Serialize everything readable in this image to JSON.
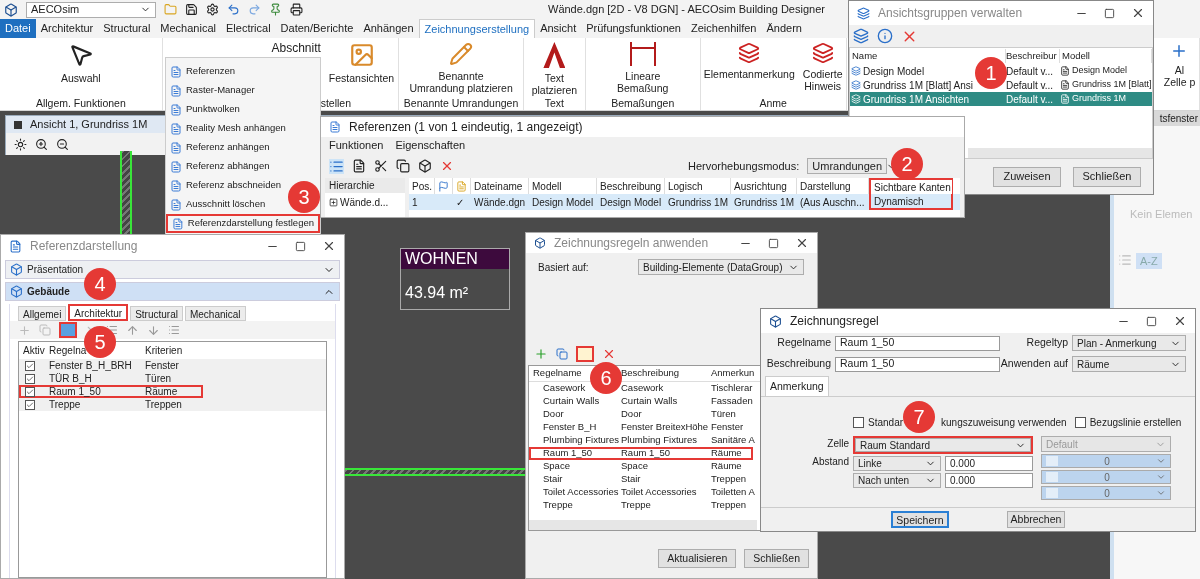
{
  "app": {
    "workspace": "AECOsim",
    "title": "Wände.dgn [2D - V8 DGN] - AECOsim Building Designer"
  },
  "ribbon_tabs": [
    {
      "label": "Datei",
      "kind": "file",
      "selected": false
    },
    {
      "label": "Architektur",
      "kind": "tab",
      "selected": false
    },
    {
      "label": "Structural",
      "kind": "tab",
      "selected": false
    },
    {
      "label": "Mechanical",
      "kind": "tab",
      "selected": false
    },
    {
      "label": "Electrical",
      "kind": "tab",
      "selected": false
    },
    {
      "label": "Daten/Berichte",
      "kind": "tab",
      "selected": false
    },
    {
      "label": "Anhängen",
      "kind": "tab",
      "selected": false
    },
    {
      "label": "Zeichnungserstellung",
      "kind": "tab",
      "selected": true
    },
    {
      "label": "Ansicht",
      "kind": "tab",
      "selected": false
    },
    {
      "label": "Prüfungsfunktionen",
      "kind": "tab",
      "selected": false
    },
    {
      "label": "Zeichenhilfen",
      "kind": "tab",
      "selected": false
    },
    {
      "label": "Ändern",
      "kind": "tab",
      "selected": false
    }
  ],
  "ribbon_groups": [
    {
      "label": "Allgem. Funktionen",
      "buttons": [
        "Auswahl"
      ]
    },
    {
      "label": "stellen",
      "buttons": [
        "Abschnitt",
        "Festansichten"
      ]
    },
    {
      "label": "Benannte Umrandungen",
      "buttons": [
        "Benannte\nUmrandung platzieren"
      ]
    },
    {
      "label": "Text",
      "buttons": [
        "Text\nplatzieren"
      ]
    },
    {
      "label": "Bemaßungen",
      "buttons": [
        "Lineare\nBemaßung"
      ]
    },
    {
      "label": "Anme",
      "buttons": [
        "Elementanmerkung",
        "Codierte\nHinweis"
      ]
    },
    {
      "buttons": [
        "Al\nZelle p"
      ]
    }
  ],
  "view_window": {
    "title": "Ansicht 1, Grundriss 1M"
  },
  "reference_menu": {
    "items": [
      {
        "label": "Referenzen",
        "marked": false
      },
      {
        "label": "Raster-Manager",
        "marked": false
      },
      {
        "label": "Punktwolken",
        "marked": false
      },
      {
        "label": "Reality Mesh anhängen",
        "marked": false
      },
      {
        "label": "Referenz anhängen",
        "marked": false
      },
      {
        "label": "Referenz abhängen",
        "marked": false
      },
      {
        "label": "Referenz abschneiden",
        "marked": false
      },
      {
        "label": "Ausschnitt löschen",
        "marked": false
      },
      {
        "label": "Referenzdarstellung festlegen",
        "marked": true
      }
    ]
  },
  "references_window": {
    "title": "Referenzen (1 von 1 eindeutig, 1 angezeigt)",
    "menus": [
      "Funktionen",
      "Eigenschaften"
    ],
    "highlight_mode": {
      "label": "Hervorhebungsmodus:",
      "value": "Umrandungen"
    },
    "hierarchy": {
      "header": "Hierarchie",
      "item": "Wände.d..."
    },
    "columns": [
      {
        "kind": "text",
        "label": "Pos.",
        "marked": false
      },
      {
        "kind": "flag",
        "marked": false
      },
      {
        "kind": "document",
        "marked": false
      },
      {
        "kind": "text",
        "label": "Dateiname",
        "marked": false
      },
      {
        "kind": "text",
        "label": "Modell",
        "marked": false
      },
      {
        "kind": "text",
        "label": "Beschreibung",
        "marked": false
      },
      {
        "kind": "text",
        "label": "Logisch",
        "marked": false
      },
      {
        "kind": "text",
        "label": "Ausrichtung",
        "marked": false
      },
      {
        "kind": "text",
        "label": "Darstellung",
        "marked": false
      },
      {
        "kind": "text",
        "label": "Sichtbare Kanten",
        "marked": true
      }
    ],
    "rows": [
      {
        "selected": true,
        "cells": [
          "1",
          null,
          "✓",
          "Wände.dgn",
          "Design Model",
          "Design Model",
          "Grundriss 1M",
          "Grundriss 1M",
          "(Aus Auschn...",
          "Dynamisch"
        ]
      }
    ]
  },
  "view_groups_window": {
    "title": "Ansichtsgruppen verwalten",
    "columns": [
      "Name",
      "Beschreibur",
      "Modell"
    ],
    "rows": [
      {
        "name": "Design Model",
        "description": "Default v...",
        "model": "Design Model",
        "selected": false
      },
      {
        "name": "Grundriss 1M [Blatt] Ansi",
        "description": "Default v...",
        "model": "Grundriss 1M [Blatt]",
        "selected": false
      },
      {
        "name": "Grundriss 1M Ansichten",
        "description": "Default v...",
        "model": "Grundriss 1M",
        "selected": true
      }
    ],
    "buttons": [
      "Zuweisen",
      "Schließen"
    ]
  },
  "side_panel": {
    "title": "tsfenster",
    "sort_button": "A-Z",
    "empty_text": "Kein Elemen"
  },
  "display_window": {
    "title": "Referenzdarstellung",
    "sections": [
      {
        "label": "Präsentation",
        "expanded": false
      },
      {
        "label": "Gebäude",
        "expanded": true
      }
    ],
    "tabs": [
      {
        "label": "Allgemei",
        "selected": false,
        "marked": false
      },
      {
        "label": "Architektur",
        "selected": true,
        "marked": true
      },
      {
        "label": "Structural",
        "selected": false,
        "marked": false
      },
      {
        "label": "Mechanical",
        "selected": false,
        "marked": false
      }
    ],
    "columns": [
      "Aktiv",
      "Regelna",
      "Kriterien"
    ],
    "rows": [
      {
        "active": true,
        "name": "Fenster B_H_BRH",
        "criteria": "Fenster",
        "marked": false
      },
      {
        "active": true,
        "name": "TÜR B_H",
        "criteria": "Türen",
        "marked": false
      },
      {
        "active": true,
        "name": "Raum 1_50",
        "criteria": "Räume",
        "marked": true
      },
      {
        "active": true,
        "name": "Treppe",
        "criteria": "Treppen",
        "marked": false
      }
    ]
  },
  "room_label": {
    "title": "WOHNEN",
    "area": "43.94 m²"
  },
  "rules_window": {
    "title": "Zeichnungsregeln anwenden",
    "based_on": {
      "label": "Basiert auf:",
      "value": "Building-Elemente (DataGroup)"
    },
    "columns": [
      "Regelname",
      "Beschreibung",
      "Anmerkun"
    ],
    "rows": [
      {
        "name": "Casework",
        "description": "Casework",
        "annotation": "Tischlerar",
        "marked": false
      },
      {
        "name": "Curtain Walls",
        "description": "Curtain Walls",
        "annotation": "Fassaden",
        "marked": false
      },
      {
        "name": "Door",
        "description": "Door",
        "annotation": "Türen",
        "marked": false
      },
      {
        "name": "Fenster B_H",
        "description": "Fenster BreitexHöhe",
        "annotation": "Fenster",
        "marked": false
      },
      {
        "name": "Plumbing Fixtures",
        "description": "Plumbing Fixtures",
        "annotation": "Sanitäre A",
        "marked": false
      },
      {
        "name": "Raum 1_50",
        "description": "Raum 1_50",
        "annotation": "Räume",
        "marked": true
      },
      {
        "name": "Space",
        "description": "Space",
        "annotation": "Räume",
        "marked": false
      },
      {
        "name": "Stair",
        "description": "Stair",
        "annotation": "Treppen",
        "marked": false
      },
      {
        "name": "Toilet Accessories",
        "description": "Toilet Accessories",
        "annotation": "Toiletten A",
        "marked": false
      },
      {
        "name": "Treppe",
        "description": "Treppe",
        "annotation": "Treppen",
        "marked": false
      }
    ],
    "buttons": [
      "Aktualisieren",
      "Schließen"
    ]
  },
  "rule_window": {
    "title": "Zeichnungsregel",
    "fields": [
      {
        "label": "Regelname",
        "value": "Raum 1_50"
      },
      {
        "label": "Beschreibung",
        "value": "Raum 1_50"
      }
    ],
    "selects": [
      {
        "label": "Regeltyp",
        "value": "Plan - Anmerkung"
      },
      {
        "label": "Anwenden auf",
        "value": "Räume"
      }
    ],
    "tab": "Anmerkung",
    "standard_checkbox": {
      "label_parts": [
        "Standar",
        "kungszuweisung verwenden"
      ],
      "checked": false
    },
    "leader_checkbox": {
      "label": "Bezugslinie erstellen",
      "checked": false
    },
    "cell": {
      "label": "Zelle",
      "value": "Raum Standard",
      "marked": true
    },
    "offset": {
      "label": "Abstand",
      "rows": [
        {
          "direction": "Linke",
          "value": "0.000"
        },
        {
          "direction": "Nach unten",
          "value": "0.000"
        }
      ]
    },
    "disabled_values": {
      "top": "Default",
      "rows": [
        "0",
        "0",
        "0"
      ]
    },
    "buttons": [
      {
        "label": "Speichern",
        "default": true
      },
      {
        "label": "Abbrechen",
        "default": false
      }
    ]
  },
  "callouts": [
    "1",
    "2",
    "3",
    "4",
    "5",
    "6",
    "7"
  ]
}
